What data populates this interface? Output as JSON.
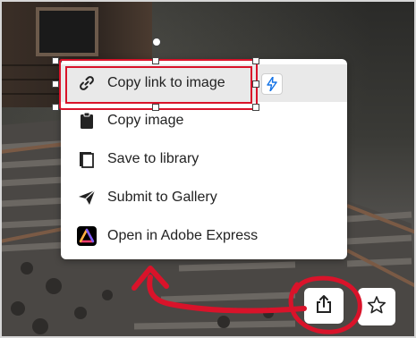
{
  "menu": {
    "items": [
      {
        "label": "Copy link to image",
        "icon": "link-icon"
      },
      {
        "label": "Copy image",
        "icon": "clipboard-icon"
      },
      {
        "label": "Save to library",
        "icon": "library-icon"
      },
      {
        "label": "Submit to Gallery",
        "icon": "send-icon"
      },
      {
        "label": "Open in Adobe Express",
        "icon": "adobe-express-icon"
      }
    ],
    "highlighted_index": 0,
    "badge_icon": "lightning-icon"
  },
  "actions": {
    "share_icon": "share-icon",
    "favorite_icon": "star-icon"
  },
  "colors": {
    "annotation": "#d9132a",
    "highlight": "#e9e9e9",
    "badge_accent": "#1473e6"
  }
}
